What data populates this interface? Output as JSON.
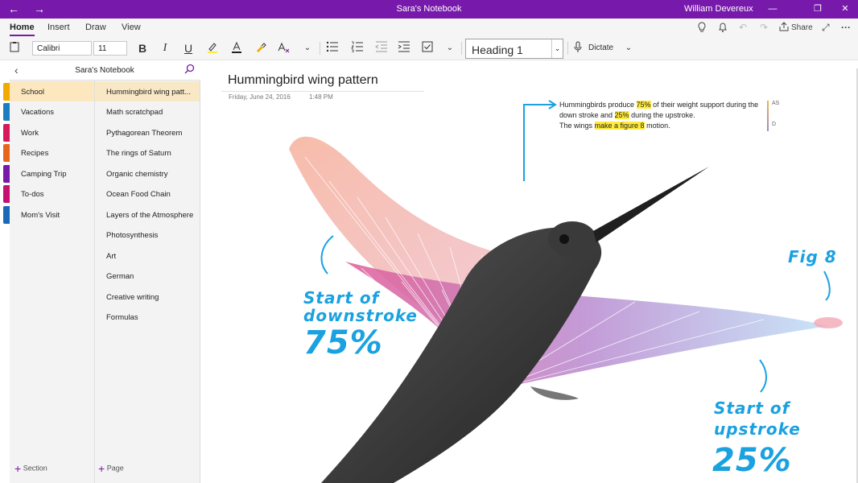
{
  "titlebar": {
    "back_icon": "←",
    "forward_icon": "→",
    "title": "Sara's Notebook",
    "user": "William Devereux",
    "minimize": "—",
    "restore": "❐",
    "close": "✕"
  },
  "ribbon": {
    "tabs": [
      "Home",
      "Insert",
      "Draw",
      "View"
    ],
    "share_label": "Share",
    "more": "···"
  },
  "toolbar": {
    "font_name": "Calibri",
    "font_size": "11",
    "bold": "B",
    "italic": "I",
    "underline": "U",
    "style_value": "Heading 1",
    "dictate_label": "Dictate"
  },
  "notebook": {
    "name": "Sara's Notebook",
    "sections": [
      {
        "label": "School",
        "color": "#f2a900"
      },
      {
        "label": "Vacations",
        "color": "#1a7fc1"
      },
      {
        "label": "Work",
        "color": "#d6195a"
      },
      {
        "label": "Recipes",
        "color": "#e8661a"
      },
      {
        "label": "Camping Trip",
        "color": "#7719aa"
      },
      {
        "label": "To-dos",
        "color": "#c4126e"
      },
      {
        "label": "Mom's Visit",
        "color": "#1a68b8"
      }
    ],
    "pages": [
      "Hummingbird wing patt...",
      "Math scratchpad",
      "Pythagorean Theorem",
      "The rings of Saturn",
      "Organic chemistry",
      "Ocean Food Chain",
      "Layers of the Atmosphere",
      "Photosynthesis",
      "Art",
      "German",
      "Creative writing",
      "Formulas"
    ],
    "add_section": "Section",
    "add_page": "Page"
  },
  "page": {
    "title": "Hummingbird wing pattern",
    "date": "Friday, June 24, 2016",
    "time": "1:48 PM",
    "note_line1_a": "Hummingbirds produce ",
    "note_hl1": "75%",
    "note_line1_b": " of their weight support during the down stroke and ",
    "note_hl2": "25%",
    "note_line1_c": " during the upstroke.",
    "note_line2_a": "The wings ",
    "note_hl3": "make a figure 8",
    "note_line2_b": " motion.",
    "side_tag_1": "AS",
    "side_tag_2": "D",
    "ink_downstroke_1": "Start of",
    "ink_downstroke_2": "downstroke",
    "ink_downstroke_pct": "75%",
    "ink_fig": "Fig 8",
    "ink_upstroke_1": "Start of",
    "ink_upstroke_2": "upstroke",
    "ink_upstroke_pct": "25%"
  }
}
